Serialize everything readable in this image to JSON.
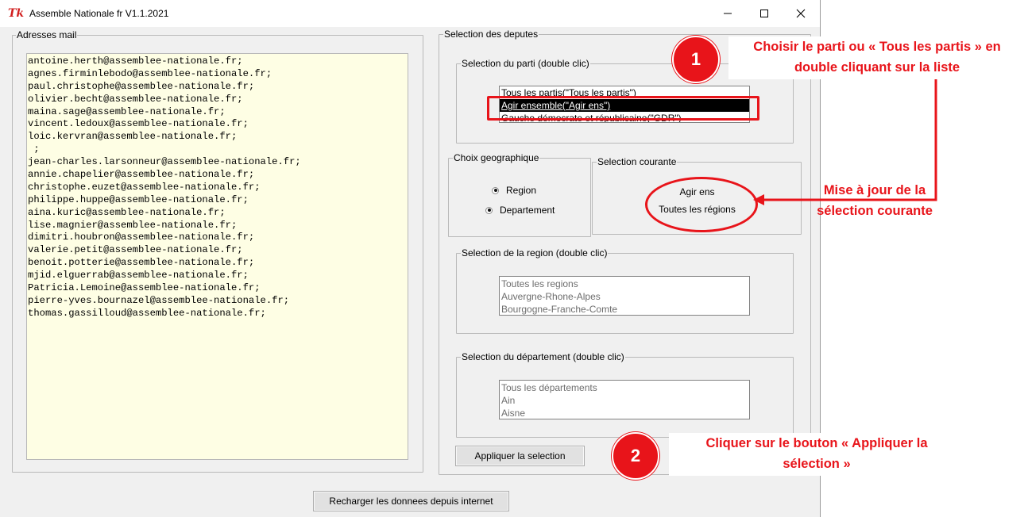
{
  "window": {
    "title": "Assemble Nationale fr V1.1.2021",
    "app_icon": "tk-logo",
    "controls": [
      "minimize-icon",
      "maximize-icon",
      "close-icon"
    ]
  },
  "emails": {
    "label": "Adresses mail",
    "lines": [
      "antoine.herth@assemblee-nationale.fr;",
      "agnes.firminlebodo@assemblee-nationale.fr;",
      "paul.christophe@assemblee-nationale.fr;",
      "olivier.becht@assemblee-nationale.fr;",
      "maina.sage@assemblee-nationale.fr;",
      "vincent.ledoux@assemblee-nationale.fr;",
      "loic.kervran@assemblee-nationale.fr;",
      " ;",
      "jean-charles.larsonneur@assemblee-nationale.fr;",
      "annie.chapelier@assemblee-nationale.fr;",
      "christophe.euzet@assemblee-nationale.fr;",
      "philippe.huppe@assemblee-nationale.fr;",
      "aina.kuric@assemblee-nationale.fr;",
      "lise.magnier@assemblee-nationale.fr;",
      "dimitri.houbron@assemblee-nationale.fr;",
      "valerie.petit@assemblee-nationale.fr;",
      "benoit.potterie@assemblee-nationale.fr;",
      "mjid.elguerrab@assemblee-nationale.fr;",
      "Patricia.Lemoine@assemblee-nationale.fr;",
      "pierre-yves.bournazel@assemblee-nationale.fr;",
      "thomas.gassilloud@assemblee-nationale.fr;"
    ]
  },
  "selection": {
    "label": "Selection des deputes",
    "parti": {
      "label": "Selection du parti (double clic)",
      "items": [
        "Tous les partis(\"Tous les partis\")",
        "Agir ensemble(\"Agir ens\")",
        "Gauche démocrate et républicaine(\"GDR\")"
      ],
      "selected_index": 1
    },
    "geo": {
      "label": "Choix geographique",
      "options": [
        "Region",
        "Departement"
      ]
    },
    "courante": {
      "label": "Selection courante",
      "line1": "Agir ens",
      "line2": "Toutes les régions"
    },
    "region": {
      "label": "Selection de la region (double clic)",
      "items": [
        "Toutes les regions",
        "Auvergne-Rhone-Alpes",
        "Bourgogne-Franche-Comte"
      ]
    },
    "departement": {
      "label": "Selection du département (double clic)",
      "items": [
        "Tous les départements",
        "Ain",
        "Aisne"
      ]
    },
    "apply_button": "Appliquer la selection"
  },
  "reload_button": "Recharger les donnees depuis internet",
  "annotations": {
    "color": "#e8141a",
    "step1_badge": "1",
    "step1_text_line1": "Choisir le parti ou « Tous les partis » en",
    "step1_text_line2": "double cliquant sur la liste",
    "update_text_line1": "Mise à jour de la",
    "update_text_line2": "sélection courante",
    "step2_badge": "2",
    "step2_text_line1": "Cliquer sur le bouton « Appliquer la",
    "step2_text_line2": "sélection »"
  }
}
